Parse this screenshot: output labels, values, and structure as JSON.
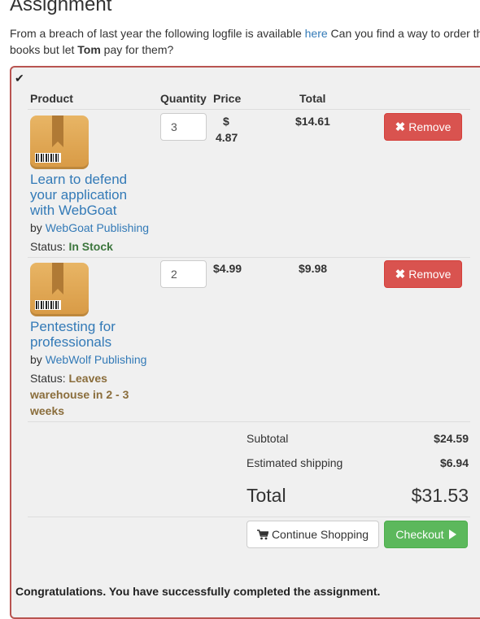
{
  "page": {
    "title": "Assignment",
    "description_part1": "From a breach of last year the following logfile is available ",
    "description_link": "here",
    "description_part2": " Can you find a way to order the books but let ",
    "description_bold": "Tom",
    "description_part3": " pay for them?"
  },
  "cart": {
    "check_glyph": "✔",
    "headers": {
      "product": "Product",
      "quantity": "Quantity",
      "price": "Price",
      "total": "Total"
    },
    "items": [
      {
        "title": "Learn to defend your application with WebGoat",
        "by_prefix": "by ",
        "publisher": "WebGoat Publishing",
        "status_prefix": "Status: ",
        "status": "In Stock",
        "quantity": "3",
        "price_symbol": "$",
        "price_amount": "4.87",
        "total": "$14.61",
        "remove_label": "Remove"
      },
      {
        "title": "Pentesting for professionals",
        "by_prefix": "by ",
        "publisher": "WebWolf Publishing",
        "status_prefix": "Status: ",
        "status": "Leaves warehouse in 2 - 3 weeks",
        "quantity": "2",
        "price": "$4.99",
        "total": "$9.98",
        "remove_label": "Remove"
      }
    ],
    "summary": {
      "subtotal_label": "Subtotal",
      "subtotal": "$24.59",
      "shipping_label": "Estimated shipping",
      "shipping": "$6.94",
      "total_label": "Total",
      "total": "$31.53"
    },
    "buttons": {
      "continue": "Continue Shopping",
      "checkout": "Checkout"
    }
  },
  "result": {
    "message": "Congratulations. You have successfully completed the assignment."
  },
  "colors": {
    "accent_link": "#337ab7",
    "remove": "#d9534f",
    "checkout": "#5cb85c",
    "panel_border": "#b85450"
  },
  "icons": [
    "check-icon",
    "book-icon",
    "remove-x-icon",
    "cart-icon",
    "play-icon"
  ]
}
